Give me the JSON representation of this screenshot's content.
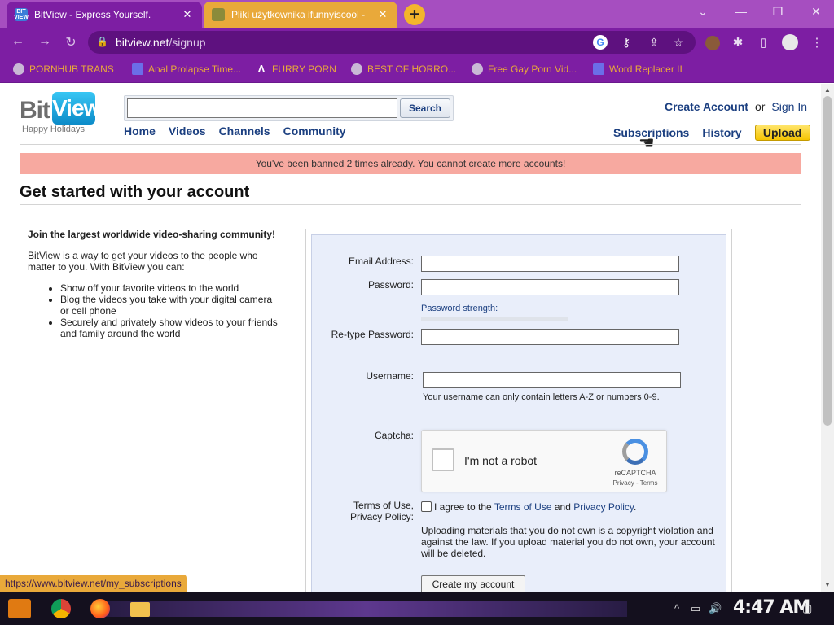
{
  "browser": {
    "tabs": [
      {
        "title": "BitView - Express Yourself.",
        "favicon": "BIT VIEW",
        "close": "✕",
        "active": true
      },
      {
        "title": "Pliki użytkownika ifunnyiscool -",
        "close": "✕",
        "active": false
      }
    ],
    "new_tab": "+",
    "window_controls": {
      "chevron": "⌄",
      "minimize": "—",
      "restore": "❐",
      "close": "✕"
    },
    "nav": {
      "back": "←",
      "forward": "→",
      "reload": "↻"
    },
    "address": {
      "host": "bitview.net",
      "path": "/signup"
    },
    "omnibox_icons": {
      "google": "G",
      "key": "⚷",
      "share": "⇪",
      "star": "☆"
    },
    "toolbar_icons": {
      "extensions": "✱",
      "sidepanel": "▯",
      "menu": "⋮"
    },
    "bookmarks": [
      {
        "label": "PORNHUB TRANS",
        "icon": "globe-icon"
      },
      {
        "label": "Anal Prolapse Time...",
        "icon": "site-icon"
      },
      {
        "label": "FURRY PORN",
        "icon": "a-logo-icon"
      },
      {
        "label": "BEST OF HORRO...",
        "icon": "globe-icon"
      },
      {
        "label": "Free Gay Porn Vid...",
        "icon": "site-icon"
      },
      {
        "label": "Word Replacer II",
        "icon": "wr-icon"
      }
    ],
    "status_url": "https://www.bitview.net/my_subscriptions"
  },
  "site": {
    "logo_bit": "Bit",
    "logo_view": "View",
    "tagline": "Happy Holidays",
    "search_button": "Search",
    "search_value": "",
    "nav": [
      "Home",
      "Videos",
      "Channels",
      "Community"
    ],
    "create_account": "Create Account",
    "or": "or",
    "sign_in": "Sign In",
    "subscriptions": "Subscriptions",
    "history": "History",
    "upload": "Upload",
    "banned_message": "You've been banned 2 times already. You cannot create more accounts!"
  },
  "signup": {
    "heading": "Get started with your account",
    "intro_lead": "Join the largest worldwide video-sharing community!",
    "intro_text": "BitView is a way to get your videos to the people who matter to you. With BitView you can:",
    "bullets": [
      "Show off your favorite videos to the world",
      "Blog the videos you take with your digital camera or cell phone",
      "Securely and privately show videos to your friends and family around the world"
    ],
    "labels": {
      "email": "Email Address:",
      "password": "Password:",
      "retype": "Re-type Password:",
      "username": "Username:",
      "captcha": "Captcha:",
      "terms_1": "Terms of Use,",
      "terms_2": "Privacy Policy:"
    },
    "password_strength": "Password strength:",
    "username_hint": "Your username can only contain letters A-Z or numbers 0-9.",
    "captcha": {
      "text": "I'm not a robot",
      "brand": "reCAPTCHA",
      "links": "Privacy - Terms"
    },
    "tos": {
      "prefix": "I agree to the",
      "terms_link": "Terms of Use",
      "and": "and",
      "privacy_link": "Privacy Policy",
      "suffix": "."
    },
    "upload_note": "Uploading materials that you do not own is a copyright violation and against the law. If you upload material you do not own, your account will be deleted.",
    "create_button": "Create my account"
  },
  "taskbar": {
    "clock": "4:47 AM",
    "tray": {
      "up": "^",
      "network": "▭",
      "volume": "🔊",
      "notifications": "▢"
    }
  }
}
